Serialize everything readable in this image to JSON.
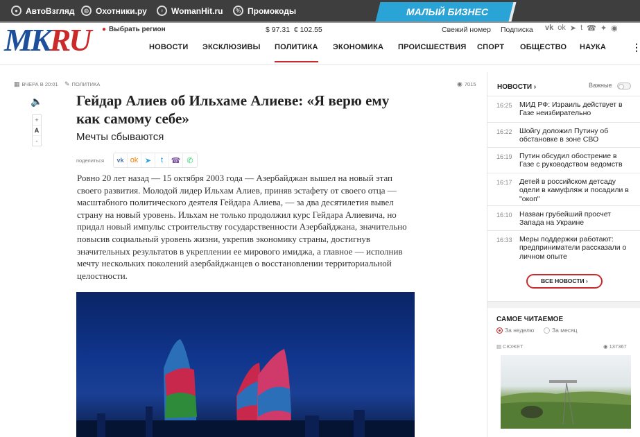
{
  "topbar": {
    "links": [
      {
        "label": "АвтоВзгляд",
        "icon": "steering-wheel-icon"
      },
      {
        "label": "Охотники.ру",
        "icon": "target-icon"
      },
      {
        "label": "WomanHit.ru",
        "icon": "female-icon"
      },
      {
        "label": "Промокоды",
        "icon": "percent-icon"
      }
    ],
    "promo_banner": "МАЛЫЙ БИЗНЕС"
  },
  "header": {
    "logo_part1": "MK",
    "logo_part2": "RU",
    "region": "Выбрать регион",
    "usd": "$ 97.31",
    "eur": "€ 102.55",
    "fresh_issue": "Свежий номер",
    "subscribe": "Подписка"
  },
  "nav": {
    "items": [
      "НОВОСТИ",
      "ЭКСКЛЮЗИВЫ",
      "ПОЛИТИКА",
      "ЭКОНОМИКА",
      "ПРОИСШЕСТВИЯ",
      "СПОРТ",
      "ОБЩЕСТВО",
      "НАУКА"
    ],
    "active": "ПОЛИТИКА"
  },
  "article": {
    "date": "ВЧЕРА В 20:01",
    "rubric": "ПОЛИТИКА",
    "views": "7015",
    "title": "Гейдар Алиев об Ильхаме Алиеве: «Я верю ему как самому себе»",
    "subtitle": "Мечты сбываются",
    "share_label": "поделиться",
    "font_plus": "+",
    "font_a": "A",
    "font_minus": "-",
    "body": "Ровно 20 лет назад — 15 октября 2003 года — Азербайджан вышел на новый этап своего развития. Молодой лидер Ильхам Алиев, приняв эстафету от своего отца — масштабного политического деятеля Гейдара Алиева, — за два десятилетия вывел страну на новый уровень. Ильхам не только продолжил курс Гейдара Алиевича, но придал новый импульс строительству государственности Азербайджана, значительно повысив социальный уровень жизни, укрепив экономику страны, достигнув значительных результатов в укреплении ее мирового имиджа, а главное — исполнив мечту нескольких поколений азербайджанцев о восстановлении территориальной целостности."
  },
  "sidebar": {
    "news_heading": "НОВОСТИ",
    "important_label": "Важные",
    "news": [
      {
        "time": "16:25",
        "text": "МИД РФ: Израиль действует в Газе неизбирательно"
      },
      {
        "time": "16:22",
        "text": "Шойгу доложил Путину об обстановке в зоне СВО"
      },
      {
        "time": "16:19",
        "text": "Путин обсудил обострение в Газе с руководством ведомств"
      },
      {
        "time": "16:17",
        "text": "Детей в российском детсаду одели в камуфляж и посадили в \"окоп\""
      },
      {
        "time": "16:10",
        "text": "Назван грубейший просчет Запада на Украине"
      },
      {
        "time": "16:33",
        "text": "Меры поддержки работают: предприниматели рассказали о личном опыте"
      }
    ],
    "all_news": "ВСЕ НОВОСТИ",
    "most_read": "САМОЕ ЧИТАЕМОЕ",
    "period_week": "За неделю",
    "period_month": "За месяц",
    "tag": "СЮЖЕТ",
    "tag_views": "137367"
  },
  "colors": {
    "brand_red": "#cb2a2a",
    "brand_blue": "#1e4f9a",
    "promo_blue": "#2aa3d6",
    "topbar": "#3e3e3e"
  }
}
